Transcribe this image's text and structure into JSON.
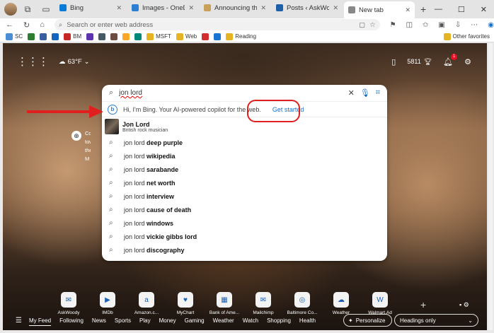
{
  "tabs": [
    {
      "label": "Bing",
      "color": "#0a7cd8",
      "active": false
    },
    {
      "label": "Images - OneDrive",
      "color": "#2d7fd4",
      "active": false
    },
    {
      "label": "Announcing the next w",
      "color": "#c9a05a",
      "active": false
    },
    {
      "label": "Posts ‹ AskWoody — W",
      "color": "#1d5fa8",
      "active": false
    },
    {
      "label": "New tab",
      "color": "#888888",
      "active": true
    }
  ],
  "address": {
    "placeholder": "Search or enter web address"
  },
  "favorites": {
    "items": [
      {
        "label": "SC",
        "color": "#4a8fd6"
      },
      {
        "label": "",
        "color": "#2e7d32"
      },
      {
        "label": "",
        "color": "#3a5fa0"
      },
      {
        "label": "",
        "color": "#1565c0"
      },
      {
        "label": "BM",
        "color": "#c62828"
      },
      {
        "label": "",
        "color": "#5e35b1"
      },
      {
        "label": "",
        "color": "#455a64"
      },
      {
        "label": "",
        "color": "#6d4c41"
      },
      {
        "label": "",
        "color": "#f9a825"
      },
      {
        "label": "",
        "color": "#00897b"
      },
      {
        "label": "MSFT",
        "color": "#e6b422"
      },
      {
        "label": "Web",
        "color": "#e6b422"
      },
      {
        "label": "",
        "color": "#d32f2f"
      },
      {
        "label": "",
        "color": "#1976d2"
      },
      {
        "label": "Reading",
        "color": "#e6b422"
      }
    ],
    "other": "Other favorites"
  },
  "top": {
    "weather": "63°F",
    "points": "5811",
    "notifications": "1"
  },
  "search": {
    "query": "jon lord",
    "copilot_text": "Hi, I'm Bing. Your AI-powered copilot for the web.",
    "get_started": "Get started",
    "entity": {
      "name": "Jon Lord",
      "desc": "British rock musician"
    },
    "suggestions": [
      {
        "prefix": "jon lord",
        "bold": "deep purple"
      },
      {
        "prefix": "jon lord",
        "bold": "wikipedia"
      },
      {
        "prefix": "jon lord",
        "bold": "sarabande"
      },
      {
        "prefix": "jon lord",
        "bold": "net worth"
      },
      {
        "prefix": "jon lord",
        "bold": "interview"
      },
      {
        "prefix": "jon lord",
        "bold": "cause of death"
      },
      {
        "prefix": "jon lord",
        "bold": "windows"
      },
      {
        "prefix": "jon lord",
        "bold": "vickie gibbs lord"
      },
      {
        "prefix": "jon lord",
        "bold": "discography"
      }
    ]
  },
  "info_blurb": [
    "Conv",
    "towa",
    "the M"
  ],
  "quick_links": [
    "AskWoody",
    "IMDb",
    "Amazon.c...",
    "MyChart",
    "Bank of Ame...",
    "Mailchimp",
    "Baltimore Co...",
    "Weather",
    "Walmart.Ad"
  ],
  "feed": {
    "items": [
      "My Feed",
      "Following",
      "News",
      "Sports",
      "Play",
      "Money",
      "Gaming",
      "Weather",
      "Watch",
      "Shopping",
      "Health"
    ],
    "personalize": "Personalize",
    "headings": "Headings only"
  },
  "colors": {
    "highlight": "#e0201e",
    "accent": "#1a6fc7"
  }
}
